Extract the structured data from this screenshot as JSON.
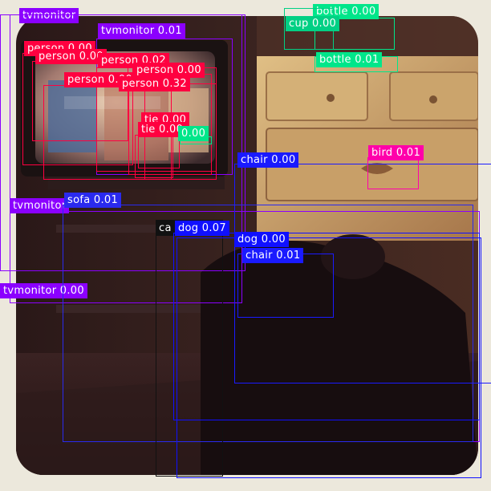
{
  "image": {
    "description_icon": "photo-living-room-tv-dresser-dog"
  },
  "colors": {
    "tvmonitor": "#8b00ff",
    "person": "#ff0040",
    "bottle": "#00e68a",
    "cup": "#00d084",
    "tie": "#ff0040",
    "chair": "#1a1aff",
    "sofa": "#2a2aee",
    "bird": "#ff00aa",
    "dog": "#1010ff",
    "cat": "#111111"
  },
  "detections": [
    {
      "label": "tvmonitor",
      "text": "tvmonitor",
      "cls": "tvmonitor"
    },
    {
      "label": "tvmonitor",
      "text": "tvmonitor 0.01",
      "cls": "tvmonitor"
    },
    {
      "label": "tvmonitor",
      "text": "tvmonitor",
      "cls": "tvmonitor"
    },
    {
      "label": "tvmonitor",
      "text": "tvmonitor 0.00",
      "cls": "tvmonitor"
    },
    {
      "label": "person",
      "text": "person 0.00",
      "cls": "person"
    },
    {
      "label": "person",
      "text": "person 0.00",
      "cls": "person"
    },
    {
      "label": "person",
      "text": "person 0.02",
      "cls": "person"
    },
    {
      "label": "person",
      "text": "person 0.00",
      "cls": "person"
    },
    {
      "label": "person",
      "text": "person 0.00",
      "cls": "person"
    },
    {
      "label": "person",
      "text": "person 0.32",
      "cls": "person"
    },
    {
      "label": "tie",
      "text": "tie 0.00",
      "cls": "tie"
    },
    {
      "label": "tie",
      "text": "tie 0.00",
      "cls": "tie"
    },
    {
      "label": "bottle",
      "text": "0.00",
      "cls": "bottle"
    },
    {
      "label": "bottle",
      "text": "bottle 0.00",
      "cls": "bottle"
    },
    {
      "label": "bottle",
      "text": "bottle 0.01",
      "cls": "bottle"
    },
    {
      "label": "cup",
      "text": "cup 0.00",
      "cls": "cup"
    },
    {
      "label": "chair",
      "text": "chair 0.00",
      "cls": "chair"
    },
    {
      "label": "chair",
      "text": "chair 0.01",
      "cls": "chair"
    },
    {
      "label": "bird",
      "text": "bird 0.01",
      "cls": "bird"
    },
    {
      "label": "sofa",
      "text": "sofa 0.01",
      "cls": "sofa"
    },
    {
      "label": "cat",
      "text": "ca",
      "cls": "cat"
    },
    {
      "label": "dog",
      "text": "dog 0.07",
      "cls": "dog"
    },
    {
      "label": "dog",
      "text": "dog 0.00",
      "cls": "dog"
    }
  ]
}
